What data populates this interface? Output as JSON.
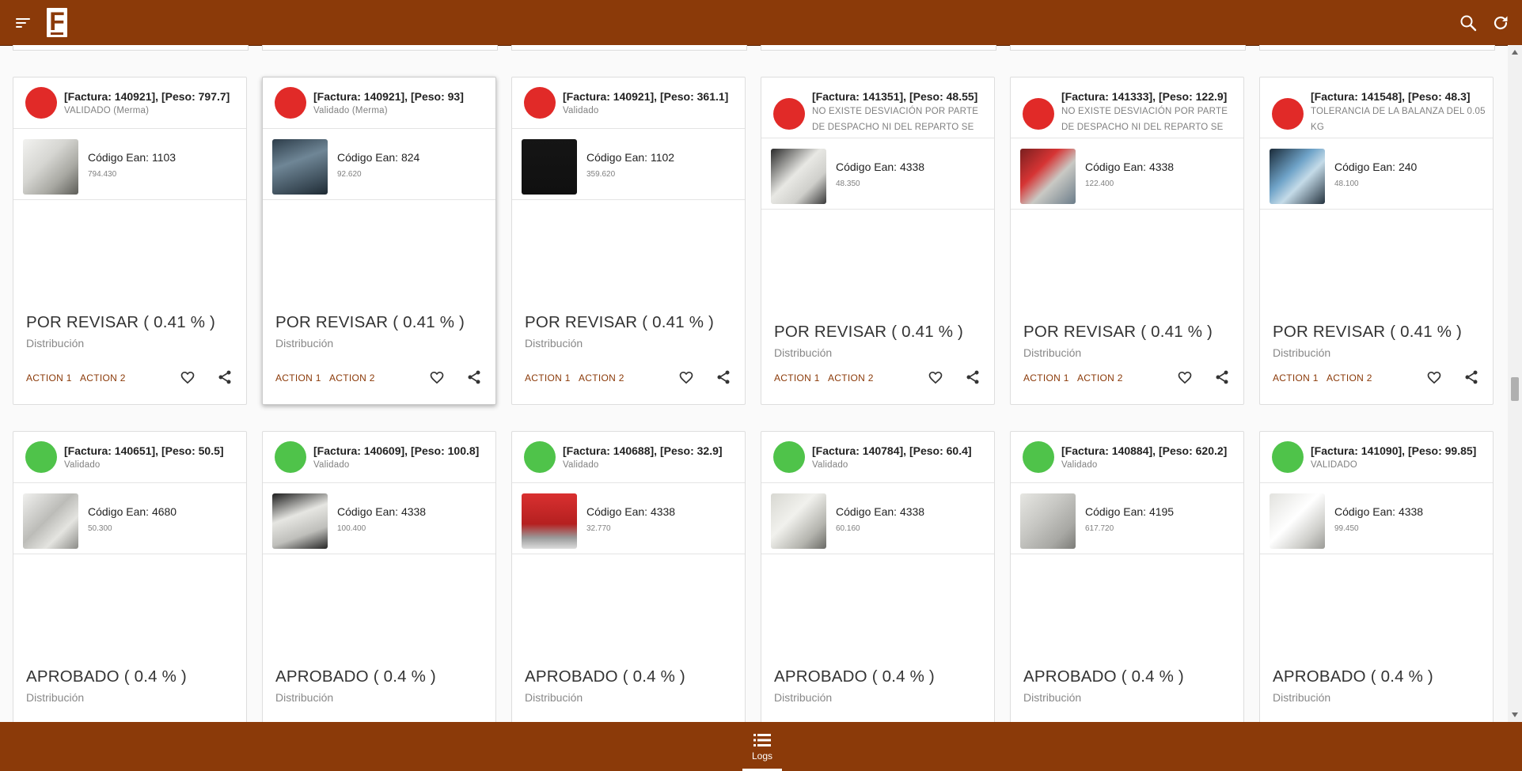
{
  "app": {
    "logo_letter": "F",
    "brand_color": "#8b3a09",
    "icons": {
      "menu": "menu-icon",
      "search": "search-icon",
      "refresh": "refresh-icon",
      "favorite": "heart-icon",
      "share": "share-icon",
      "logs": "list-icon"
    }
  },
  "cards": [
    {
      "status_color": "red",
      "title": "[Factura: 140921], [Peso: 797.7]",
      "subtitle": "VALIDADO (Merma)",
      "ean": "Código Ean: 1103",
      "weight": "794.430",
      "status": "POR REVISAR ( 0.41 % )",
      "department": "Distribución",
      "action1": "ACTION 1",
      "action2": "ACTION 2"
    },
    {
      "status_color": "red",
      "title": "[Factura: 140921], [Peso: 93]",
      "subtitle": "Validado (Merma)",
      "ean": "Código Ean: 824",
      "weight": "92.620",
      "status": "POR REVISAR ( 0.41 % )",
      "department": "Distribución",
      "action1": "ACTION 1",
      "action2": "ACTION 2"
    },
    {
      "status_color": "red",
      "title": "[Factura: 140921], [Peso: 361.1]",
      "subtitle": "Validado",
      "ean": "Código Ean: 1102",
      "weight": "359.620",
      "status": "POR REVISAR ( 0.41 % )",
      "department": "Distribución",
      "action1": "ACTION 1",
      "action2": "ACTION 2"
    },
    {
      "status_color": "red",
      "title": "[Factura: 141351], [Peso: 48.55]",
      "subtitle": "NO EXISTE DESVIACIÓN POR PARTE DE DESPACHO NI DEL REPARTO SE VALIDA TODAS LOS REPORTES DE DESPACHO Y",
      "ean": "Código Ean: 4338",
      "weight": "48.350",
      "status": "POR REVISAR ( 0.41 % )",
      "department": "Distribución",
      "action1": "ACTION 1",
      "action2": "ACTION 2"
    },
    {
      "status_color": "red",
      "title": "[Factura: 141333], [Peso: 122.9]",
      "subtitle": "NO EXISTE DESVIACIÓN POR PARTE DE DESPACHO NI DEL REPARTO SE VALIDA TODAS LOS REPORTES DE DESPACHO Y",
      "ean": "Código Ean: 4338",
      "weight": "122.400",
      "status": "POR REVISAR ( 0.41 % )",
      "department": "Distribución",
      "action1": "ACTION 1",
      "action2": "ACTION 2"
    },
    {
      "status_color": "red",
      "title": "[Factura: 141548], [Peso: 48.3]",
      "subtitle": "TOLERANCIA DE LA BALANZA DEL 0.05 KG",
      "ean": "Código Ean: 240",
      "weight": "48.100",
      "status": "POR REVISAR ( 0.41 % )",
      "department": "Distribución",
      "action1": "ACTION 1",
      "action2": "ACTION 2"
    },
    {
      "status_color": "green",
      "title": "[Factura: 140651], [Peso: 50.5]",
      "subtitle": "Validado",
      "ean": "Código Ean: 4680",
      "weight": "50.300",
      "status": "APROBADO ( 0.4 % )",
      "department": "Distribución",
      "action1": "ACTION 1",
      "action2": "ACTION 2"
    },
    {
      "status_color": "green",
      "title": "[Factura: 140609], [Peso: 100.8]",
      "subtitle": "Validado",
      "ean": "Código Ean: 4338",
      "weight": "100.400",
      "status": "APROBADO ( 0.4 % )",
      "department": "Distribución",
      "action1": "ACTION 1",
      "action2": "ACTION 2"
    },
    {
      "status_color": "green",
      "title": "[Factura: 140688], [Peso: 32.9]",
      "subtitle": "Validado",
      "ean": "Código Ean: 4338",
      "weight": "32.770",
      "status": "APROBADO ( 0.4 % )",
      "department": "Distribución",
      "action1": "ACTION 1",
      "action2": "ACTION 2"
    },
    {
      "status_color": "green",
      "title": "[Factura: 140784], [Peso: 60.4]",
      "subtitle": "Validado",
      "ean": "Código Ean: 4338",
      "weight": "60.160",
      "status": "APROBADO ( 0.4 % )",
      "department": "Distribución",
      "action1": "ACTION 1",
      "action2": "ACTION 2"
    },
    {
      "status_color": "green",
      "title": "[Factura: 140884], [Peso: 620.2]",
      "subtitle": "Validado",
      "ean": "Código Ean: 4195",
      "weight": "617.720",
      "status": "APROBADO ( 0.4 % )",
      "department": "Distribución",
      "action1": "ACTION 1",
      "action2": "ACTION 2"
    },
    {
      "status_color": "green",
      "title": "[Factura: 141090], [Peso: 99.85]",
      "subtitle": "VALIDADO",
      "ean": "Código Ean: 4338",
      "weight": "99.450",
      "status": "APROBADO ( 0.4 % )",
      "department": "Distribución",
      "action1": "ACTION 1",
      "action2": "ACTION 2"
    }
  ],
  "bottom_nav": {
    "logs_label": "Logs"
  }
}
